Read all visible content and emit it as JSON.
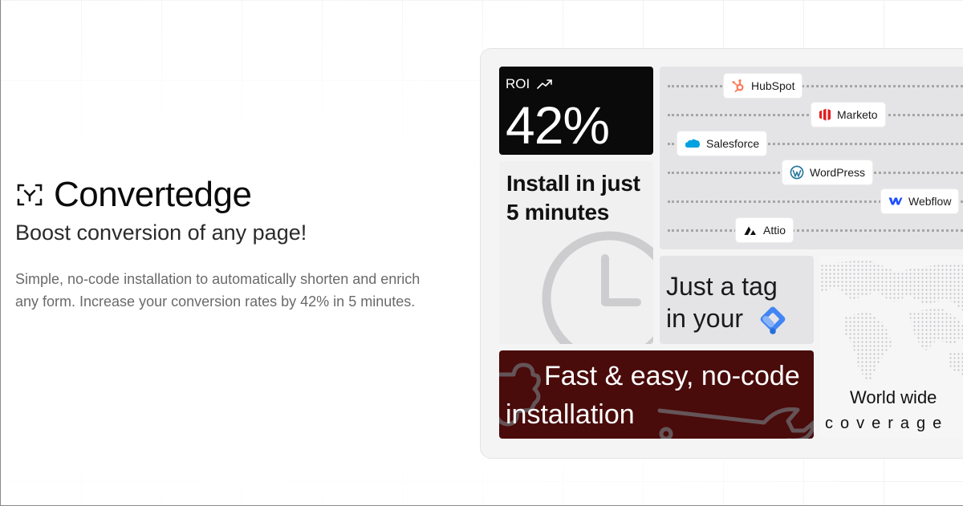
{
  "brand": {
    "name": "Convertedge",
    "logo_icon": "focus-brackets-icon"
  },
  "hero": {
    "tagline": "Boost conversion of any page!",
    "description": "Simple, no-code installation to automatically shorten and enrich any form. Increase your conversion rates by 42% in 5 minutes."
  },
  "cards": {
    "roi": {
      "label": "ROI",
      "value": "42%",
      "icon": "trending-up-icon"
    },
    "install": {
      "line1": "Install in just",
      "line2": "5 minutes",
      "icon": "clock-icon"
    },
    "integrations": [
      {
        "name": "HubSpot",
        "icon": "hubspot-icon",
        "color": "#ff7a59"
      },
      {
        "name": "Marketo",
        "icon": "marketo-icon",
        "color": "#e02020"
      },
      {
        "name": "Salesforce",
        "icon": "salesforce-icon",
        "color": "#00a1e0"
      },
      {
        "name": "WordPress",
        "icon": "wordpress-icon",
        "color": "#21759b"
      },
      {
        "name": "Webflow",
        "icon": "webflow-icon",
        "color": "#1e4fff"
      },
      {
        "name": "Attio",
        "icon": "attio-icon",
        "color": "#111111"
      }
    ],
    "tag": {
      "line1": "Just a tag",
      "line2": "in your",
      "icon": "google-tag-manager-icon"
    },
    "fast": {
      "line1": "Fast & easy, no-code",
      "line2": "installation",
      "icon": "puzzle-wrench-icon"
    },
    "map": {
      "title": "World wide",
      "subtitle": "coverage",
      "icon": "world-map-icon"
    }
  },
  "colors": {
    "roi_bg": "#0a0a0a",
    "fast_bg": "#4a0b0b",
    "tile_bg": "#e4e4e6",
    "panel_bg": "#f4f4f5",
    "text_muted": "#6a6a6a"
  }
}
